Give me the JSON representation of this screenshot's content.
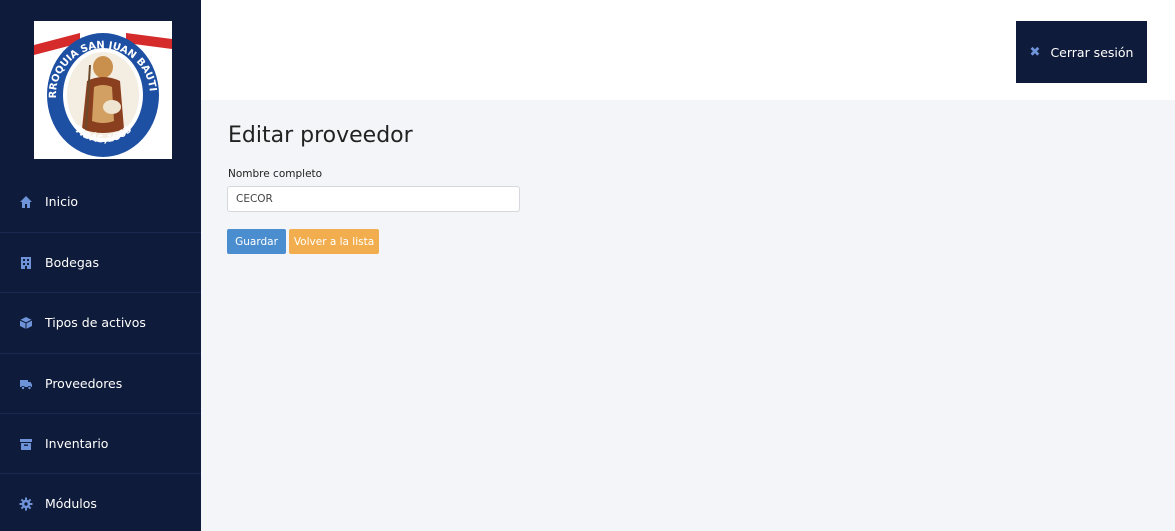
{
  "sidebar": {
    "logo": {
      "top_text": "PARROQUIA SAN JUAN BAUTISTA",
      "bottom_text": "TIBÁS, 1865"
    },
    "items": [
      {
        "label": "Inicio",
        "icon": "home-icon"
      },
      {
        "label": "Bodegas",
        "icon": "building-icon"
      },
      {
        "label": "Tipos de activos",
        "icon": "cube-icon"
      },
      {
        "label": "Proveedores",
        "icon": "truck-icon"
      },
      {
        "label": "Inventario",
        "icon": "archive-icon"
      },
      {
        "label": "Módulos",
        "icon": "gear-icon"
      }
    ]
  },
  "header": {
    "logout_label": "Cerrar sesión"
  },
  "main": {
    "title": "Editar proveedor",
    "form": {
      "name_label": "Nombre completo",
      "name_value": "CECOR"
    },
    "buttons": {
      "save": "Guardar",
      "back": "Volver a la lista"
    }
  },
  "colors": {
    "sidebar_bg": "#0f1b3a",
    "icon_accent": "#6f93d8",
    "save_button": "#4a8ed0",
    "back_button": "#f2ae4e",
    "content_bg": "#f4f5f8"
  }
}
